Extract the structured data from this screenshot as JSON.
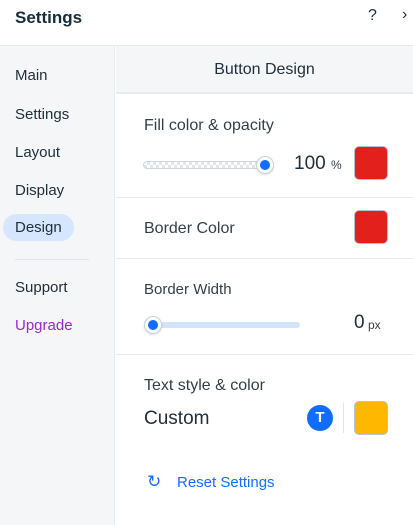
{
  "header": {
    "title": "Settings",
    "help": "?",
    "close": "›"
  },
  "sidebar": {
    "items": [
      {
        "label": "Main"
      },
      {
        "label": "Settings"
      },
      {
        "label": "Layout"
      },
      {
        "label": "Display"
      },
      {
        "label": "Design"
      },
      {
        "label": "Support"
      },
      {
        "label": "Upgrade"
      }
    ],
    "active": "Design"
  },
  "main": {
    "title": "Button Design",
    "fill": {
      "label": "Fill color & opacity",
      "value": "100",
      "unit": "%",
      "color": "#e3201b"
    },
    "border_color": {
      "label": "Border Color",
      "color": "#e3201b"
    },
    "border_width": {
      "label": "Border Width",
      "value": "0",
      "unit": "px"
    },
    "text_style": {
      "label": "Text style & color",
      "value": "Custom",
      "icon_glyph": "T",
      "color": "#ffb700"
    },
    "reset": {
      "label": "Reset Settings",
      "icon": "↻"
    }
  },
  "colors": {
    "accent": "#116dff",
    "upgrade": "#9a27d5",
    "active_nav_bg": "#d6e6fe"
  }
}
